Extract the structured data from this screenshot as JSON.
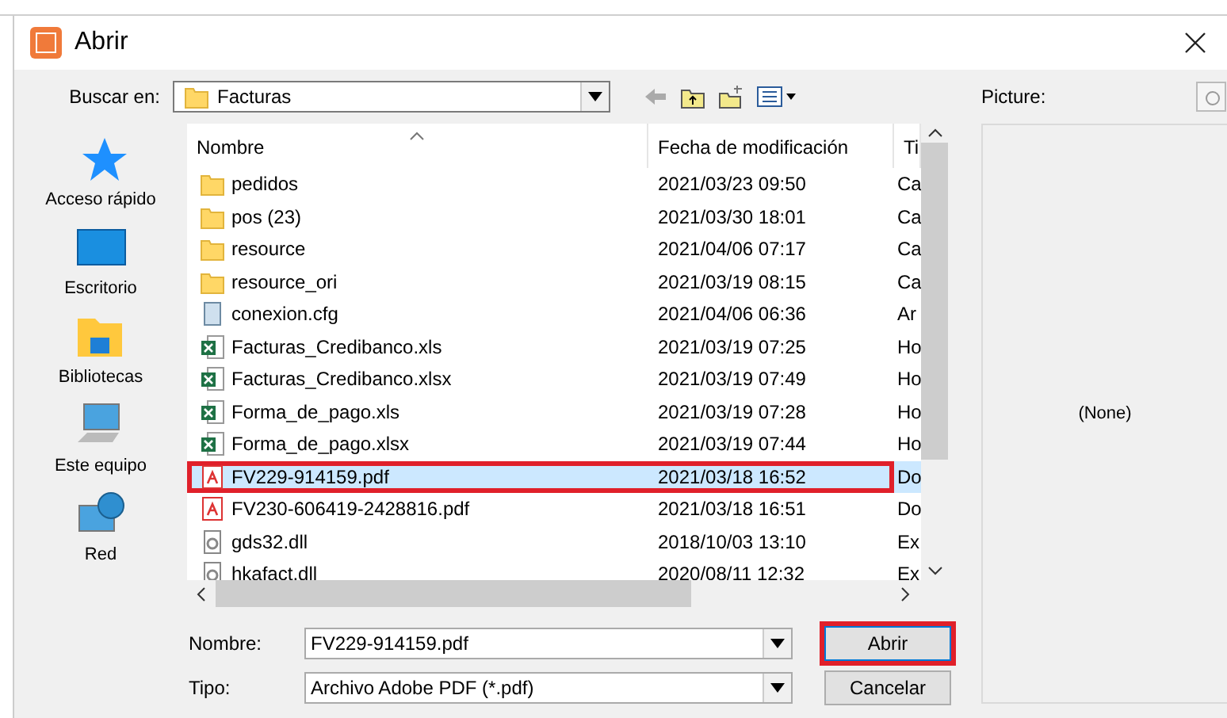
{
  "window": {
    "title": "Abrir"
  },
  "look_in": {
    "label": "Buscar en:",
    "value": "Facturas"
  },
  "places": [
    {
      "label": "Acceso rápido",
      "kind": "star"
    },
    {
      "label": "Escritorio",
      "kind": "desktop"
    },
    {
      "label": "Bibliotecas",
      "kind": "library"
    },
    {
      "label": "Este equipo",
      "kind": "computer"
    },
    {
      "label": "Red",
      "kind": "network"
    }
  ],
  "table": {
    "columns": [
      "Nombre",
      "Fecha de modificación",
      "Ti"
    ],
    "rows": [
      {
        "name": "pedidos",
        "date": "2021/03/23 09:50",
        "type": "Ca",
        "kind": "folder",
        "selected": false,
        "highlighted": false
      },
      {
        "name": "pos (23)",
        "date": "2021/03/30 18:01",
        "type": "Ca",
        "kind": "folder",
        "selected": false,
        "highlighted": false
      },
      {
        "name": "resource",
        "date": "2021/04/06 07:17",
        "type": "Ca",
        "kind": "folder",
        "selected": false,
        "highlighted": false
      },
      {
        "name": "resource_ori",
        "date": "2021/03/19 08:15",
        "type": "Ca",
        "kind": "folder",
        "selected": false,
        "highlighted": false
      },
      {
        "name": "conexion.cfg",
        "date": "2021/04/06 06:36",
        "type": "Ar",
        "kind": "text",
        "selected": false,
        "highlighted": false
      },
      {
        "name": "Facturas_Credibanco.xls",
        "date": "2021/03/19 07:25",
        "type": "Ho",
        "kind": "xls",
        "selected": false,
        "highlighted": false
      },
      {
        "name": "Facturas_Credibanco.xlsx",
        "date": "2021/03/19 07:49",
        "type": "Ho",
        "kind": "xlsx",
        "selected": false,
        "highlighted": false
      },
      {
        "name": "Forma_de_pago.xls",
        "date": "2021/03/19 07:28",
        "type": "Ho",
        "kind": "xls",
        "selected": false,
        "highlighted": false
      },
      {
        "name": "Forma_de_pago.xlsx",
        "date": "2021/03/19 07:44",
        "type": "Ho",
        "kind": "xlsx",
        "selected": false,
        "highlighted": false
      },
      {
        "name": "FV229-914159.pdf",
        "date": "2021/03/18 16:52",
        "type": "Do",
        "kind": "pdf",
        "selected": true,
        "highlighted": true
      },
      {
        "name": "FV230-606419-2428816.pdf",
        "date": "2021/03/18 16:51",
        "type": "Do",
        "kind": "pdf",
        "selected": false,
        "highlighted": false
      },
      {
        "name": "gds32.dll",
        "date": "2018/10/03 13:10",
        "type": "Ex",
        "kind": "dll",
        "selected": false,
        "highlighted": false
      },
      {
        "name": "hkafact.dll",
        "date": "2020/08/11 12:32",
        "type": "Ex",
        "kind": "dll",
        "selected": false,
        "highlighted": false
      }
    ]
  },
  "file_name": {
    "label": "Nombre:",
    "value": "FV229-914159.pdf"
  },
  "file_type": {
    "label": "Tipo:",
    "value": "Archivo Adobe PDF (*.pdf)"
  },
  "buttons": [
    {
      "label": "Abrir",
      "highlighted": true
    },
    {
      "label": "Cancelar",
      "highlighted": false
    }
  ],
  "preview": {
    "label": "Picture:",
    "value": "(None)"
  }
}
